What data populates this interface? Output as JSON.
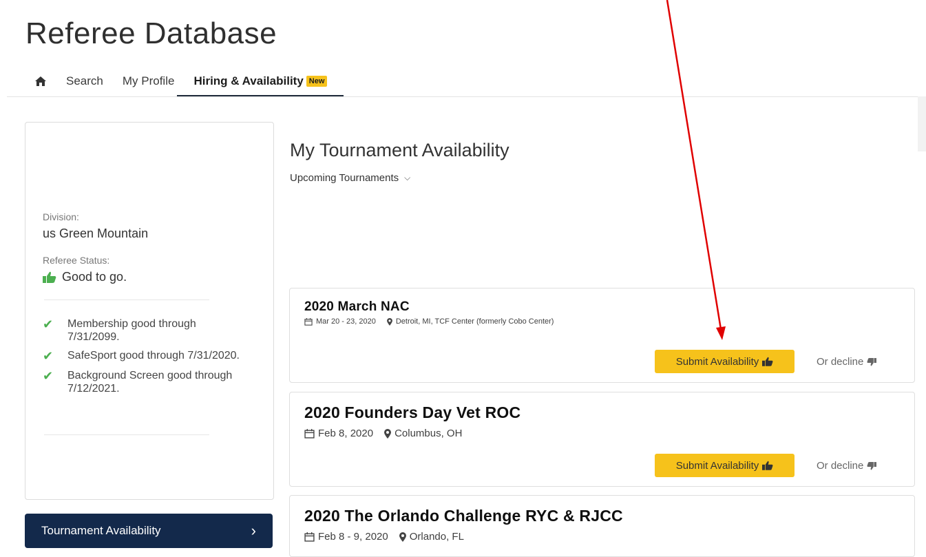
{
  "app": {
    "title": "Referee Database"
  },
  "nav": {
    "home_icon": "home-icon",
    "items": [
      {
        "label": "Search"
      },
      {
        "label": "My Profile"
      },
      {
        "label": "Hiring & Availability",
        "badge": "New",
        "active": true
      }
    ]
  },
  "sidebar": {
    "division_label": "Division:",
    "division_value": "us Green Mountain",
    "status_label": "Referee Status:",
    "status_value": "Good to go.",
    "checks": [
      {
        "text": "Membership good through 7/31/2099."
      },
      {
        "text": "SafeSport good through 7/31/2020."
      },
      {
        "text": "Background Screen good through 7/12/2021."
      }
    ],
    "button_label": "Tournament Availability",
    "button_chevron": "›"
  },
  "main": {
    "title": "My Tournament Availability",
    "filter_label": "Upcoming Tournaments",
    "cards": [
      {
        "title": "2020 March NAC",
        "dates": "Mar 20 - 23, 2020",
        "location": "Detroit, MI, TCF Center (formerly Cobo Center)",
        "submit_label": "Submit Availability",
        "decline_label": "Or decline"
      },
      {
        "title": "2020 Founders Day Vet ROC",
        "dates": "Feb 8, 2020",
        "location": "Columbus, OH",
        "submit_label": "Submit Availability",
        "decline_label": "Or decline"
      },
      {
        "title": "2020 The Orlando Challenge RYC & RJCC",
        "dates": "Feb 8 - 9, 2020",
        "location": "Orlando, FL"
      }
    ]
  },
  "colors": {
    "accent_yellow": "#f6c21b",
    "navy": "#13294b",
    "check_green": "#4caf50",
    "annotation_red": "#e00000"
  }
}
